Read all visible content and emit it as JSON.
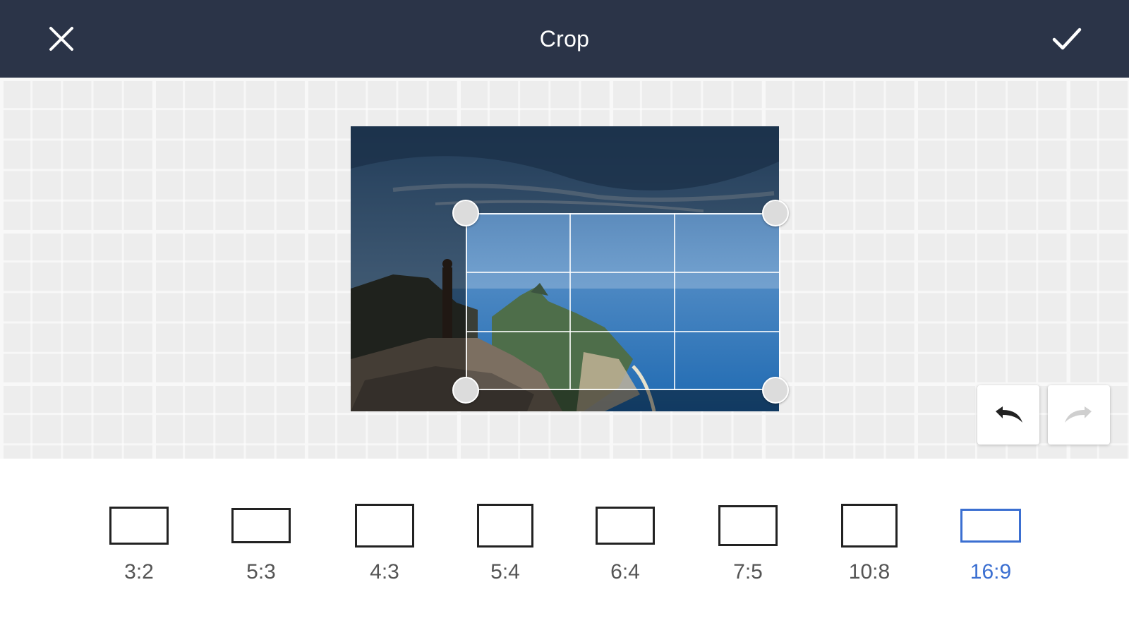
{
  "header": {
    "title": "Crop",
    "close_icon": "close-icon",
    "confirm_icon": "checkmark-icon"
  },
  "history": {
    "undo_icon": "undo-icon",
    "redo_icon": "redo-icon",
    "redo_enabled": false
  },
  "ratios": {
    "selected": "16:9",
    "items": [
      {
        "label": "3:2"
      },
      {
        "label": "5:3"
      },
      {
        "label": "4:3"
      },
      {
        "label": "5:4"
      },
      {
        "label": "6:4"
      },
      {
        "label": "7:5"
      },
      {
        "label": "10:8"
      },
      {
        "label": "16:9"
      }
    ]
  },
  "colors": {
    "header_bg": "#2b3448",
    "accent": "#3b6fd1",
    "canvas_bg": "#ededed"
  }
}
